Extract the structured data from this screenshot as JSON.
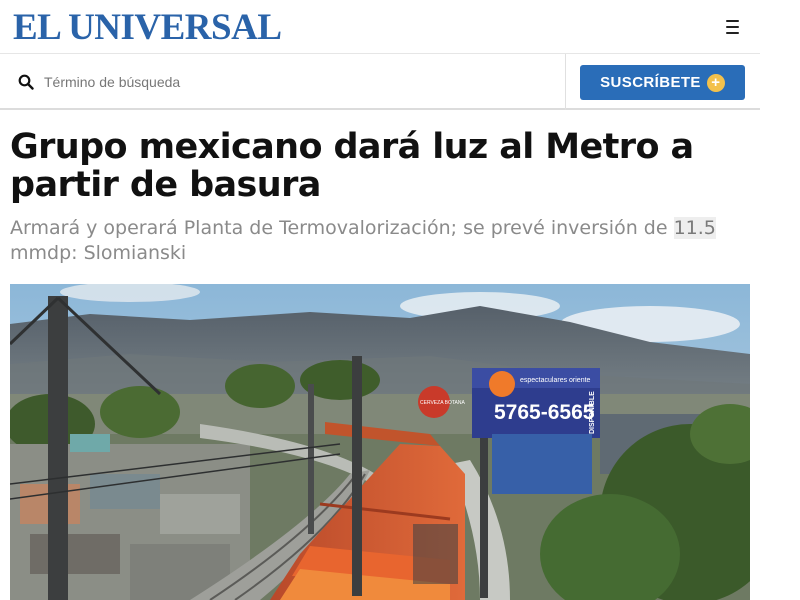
{
  "header": {
    "logo": "EL UNIVERSAL",
    "menu_icon": "hamburger-menu-icon"
  },
  "search": {
    "placeholder": "Término de búsqueda",
    "icon": "search-icon"
  },
  "subscribe": {
    "label": "SUSCRÍBETE",
    "icon": "plus-icon",
    "icon_glyph": "+"
  },
  "article": {
    "headline": "Grupo mexicano dará luz al Metro a partir de basura",
    "subhead_before": "Armará y operará Planta de Termovalorización; se prevé inversión de ",
    "subhead_highlight": "11.5",
    "subhead_after": " mmdp: Slomianski"
  },
  "photo": {
    "billboard_brand": "espectaculares oriente",
    "billboard_phone": "5765-6565",
    "billboard_side": "DISPONIBLE",
    "small_sign": "CERVEZA BOTANA"
  },
  "colors": {
    "brand_blue": "#2a63a9",
    "button_blue": "#2a6db8",
    "plus_yellow": "#f3c14c",
    "train_orange": "#d9532b"
  }
}
